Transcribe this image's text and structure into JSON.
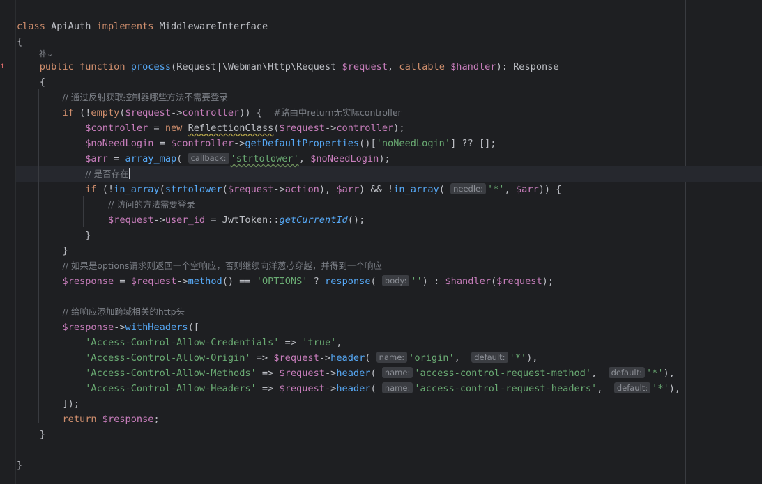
{
  "editor": {
    "hints": {
      "callback": "callback:",
      "needle": "needle:",
      "body": "body:",
      "name": "name:",
      "default": "default:"
    },
    "ai_marker": "䃼⌄",
    "override_marker": "↑"
  },
  "code": {
    "class_kw": "class",
    "class_name": "ApiAuth",
    "implements_kw": "implements",
    "interface": "MiddlewareInterface",
    "public_kw": "public",
    "function_kw": "function",
    "method_name": "process",
    "comment_reflection": "// 通过反射获取控制器哪些方法不需要登录",
    "comment_route": "#路由中return无实际controller",
    "comment_exists": "// 是否存在",
    "comment_access": "// 访问的方法需要登录",
    "comment_options": "// 如果是options请求则返回一个空响应，否则继续向洋葱芯穿越，并得到一个响应",
    "comment_headers": "// 给响应添加跨域相关的http头",
    "str_noNeedLogin": "'noNeedLogin'",
    "str_strtolower": "'strtolower'",
    "str_star": "'*'",
    "str_options": "'OPTIONS'",
    "str_empty": "''",
    "str_credentials": "'Access-Control-Allow-Credentials'",
    "str_true": "'true'",
    "str_allow_origin": "'Access-Control-Allow-Origin'",
    "str_origin": "'origin'",
    "str_allow_methods": "'Access-Control-Allow-Methods'",
    "str_req_method": "'access-control-request-method'",
    "str_allow_headers": "'Access-Control-Allow-Headers'",
    "str_req_headers": "'access-control-request-headers'"
  }
}
